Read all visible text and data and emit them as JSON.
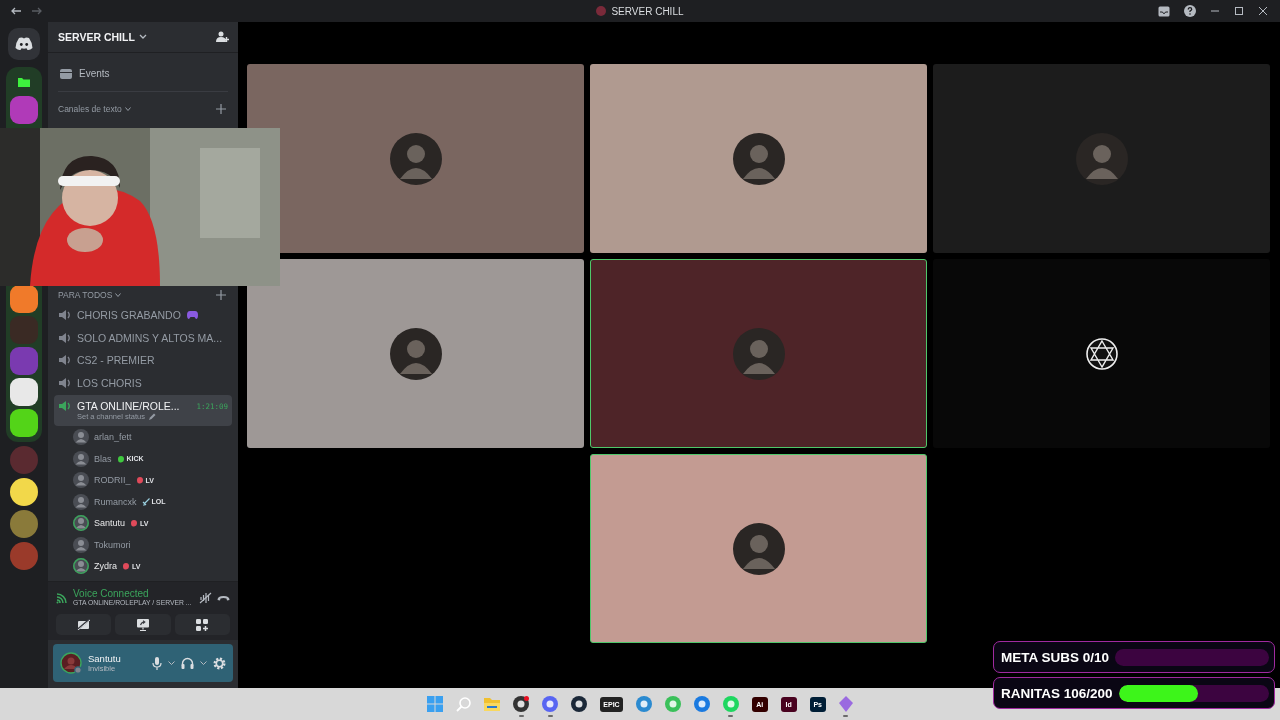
{
  "window": {
    "title": "SERVER CHILL"
  },
  "rail": {
    "folder": {
      "color": "#213d26",
      "servers": [
        {
          "color": "#b03ab8"
        }
      ],
      "servers_lower": [
        {
          "color": "#f07a2a"
        },
        {
          "color": "#3a2a24"
        },
        {
          "color": "#7a3ab0"
        },
        {
          "color": "#e8e8e8"
        },
        {
          "color": "#53d418"
        }
      ]
    },
    "servers": [
      {
        "color": "#5a2a30"
      },
      {
        "color": "#f2d84a"
      },
      {
        "color": "#8a7a3a"
      },
      {
        "color": "#9a3a2a"
      }
    ]
  },
  "server": {
    "name": "SERVER CHILL",
    "events": "Events"
  },
  "categories": [
    {
      "name": "Canales de texto"
    },
    {
      "name": "PARA TODOS"
    }
  ],
  "channels": [
    {
      "name": "CHORIS GRABANDO",
      "has_icon": true,
      "selected": false
    },
    {
      "name": "SOLO ADMINS Y ALTOS MA...",
      "has_icon": false,
      "selected": false
    },
    {
      "name": "CS2 - PREMIER",
      "has_icon": false,
      "selected": false
    },
    {
      "name": "LOS CHORIS",
      "has_icon": false,
      "selected": false
    },
    {
      "name": "GTA ONLINE/ROLE...",
      "has_icon": false,
      "selected": true,
      "timer": "1:21:09",
      "status": "Set a channel status"
    }
  ],
  "members": [
    {
      "name": "arlan_fett",
      "speaking": false
    },
    {
      "name": "Blas",
      "speaking": false,
      "tag": {
        "text": "KICK",
        "kind": "blob",
        "color": "#3fc83f"
      }
    },
    {
      "name": "RODRII_",
      "speaking": false,
      "tag": {
        "text": "LV",
        "kind": "blob",
        "color": "#e04a5a"
      }
    },
    {
      "name": "Rumancxk",
      "speaking": false,
      "tag": {
        "text": "LOL",
        "kind": "sword",
        "color": "#9ad0e0"
      }
    },
    {
      "name": "Santutu",
      "speaking": true,
      "tag": {
        "text": "LV",
        "kind": "blob",
        "color": "#e04a5a"
      }
    },
    {
      "name": "Tokumori",
      "speaking": false
    },
    {
      "name": "Zydra",
      "speaking": true,
      "tag": {
        "text": "LV",
        "kind": "blob",
        "color": "#e04a5a"
      }
    }
  ],
  "voice": {
    "status": "Voice Connected",
    "channel": "GTA ONLINE/ROLEPLAY / SERVER ..."
  },
  "user": {
    "name": "Santutu",
    "status": "Invisible"
  },
  "tiles": [
    {
      "color": "#7a6660",
      "speaking": false,
      "kind": "avatar"
    },
    {
      "color": "#b09a90",
      "speaking": false,
      "kind": "avatar"
    },
    {
      "color": "#1c1c1c",
      "speaking": false,
      "kind": "avatar"
    },
    {
      "color": "#9e9896",
      "speaking": false,
      "kind": "avatar"
    },
    {
      "color": "#4e2428",
      "speaking": true,
      "kind": "avatar"
    },
    {
      "color": "#080808",
      "speaking": false,
      "kind": "emblem"
    },
    {
      "color": "#c39b92",
      "speaking": true,
      "kind": "avatar"
    }
  ],
  "goals": [
    {
      "label": "META SUBS 0/10",
      "level": 0
    },
    {
      "label": "RANITAS 106/200",
      "level": 0.53
    }
  ],
  "taskbar": [
    {
      "kind": "windows",
      "running": false
    },
    {
      "kind": "search",
      "running": false
    },
    {
      "kind": "files",
      "running": false
    },
    {
      "kind": "circle",
      "color": "#333333",
      "running": true,
      "notification": true
    },
    {
      "kind": "circle",
      "color": "#5865f2",
      "running": true
    },
    {
      "kind": "circle",
      "color": "#1b2838",
      "running": false
    },
    {
      "kind": "tile",
      "color": "#222222",
      "label": "EPIC",
      "running": false
    },
    {
      "kind": "circle",
      "color": "#2a8ad0",
      "running": false
    },
    {
      "kind": "circle",
      "color": "#3ac05a",
      "running": false
    },
    {
      "kind": "circle",
      "color": "#1a7ae0",
      "running": false
    },
    {
      "kind": "circle",
      "color": "#1ed760",
      "running": true
    },
    {
      "kind": "tile",
      "color": "#330000",
      "label": "Ai",
      "running": false
    },
    {
      "kind": "tile",
      "color": "#49021f",
      "label": "Id",
      "running": false
    },
    {
      "kind": "tile",
      "color": "#001e36",
      "label": "Ps",
      "running": false
    },
    {
      "kind": "diamond",
      "color": "#9a6ae0",
      "running": true
    }
  ]
}
